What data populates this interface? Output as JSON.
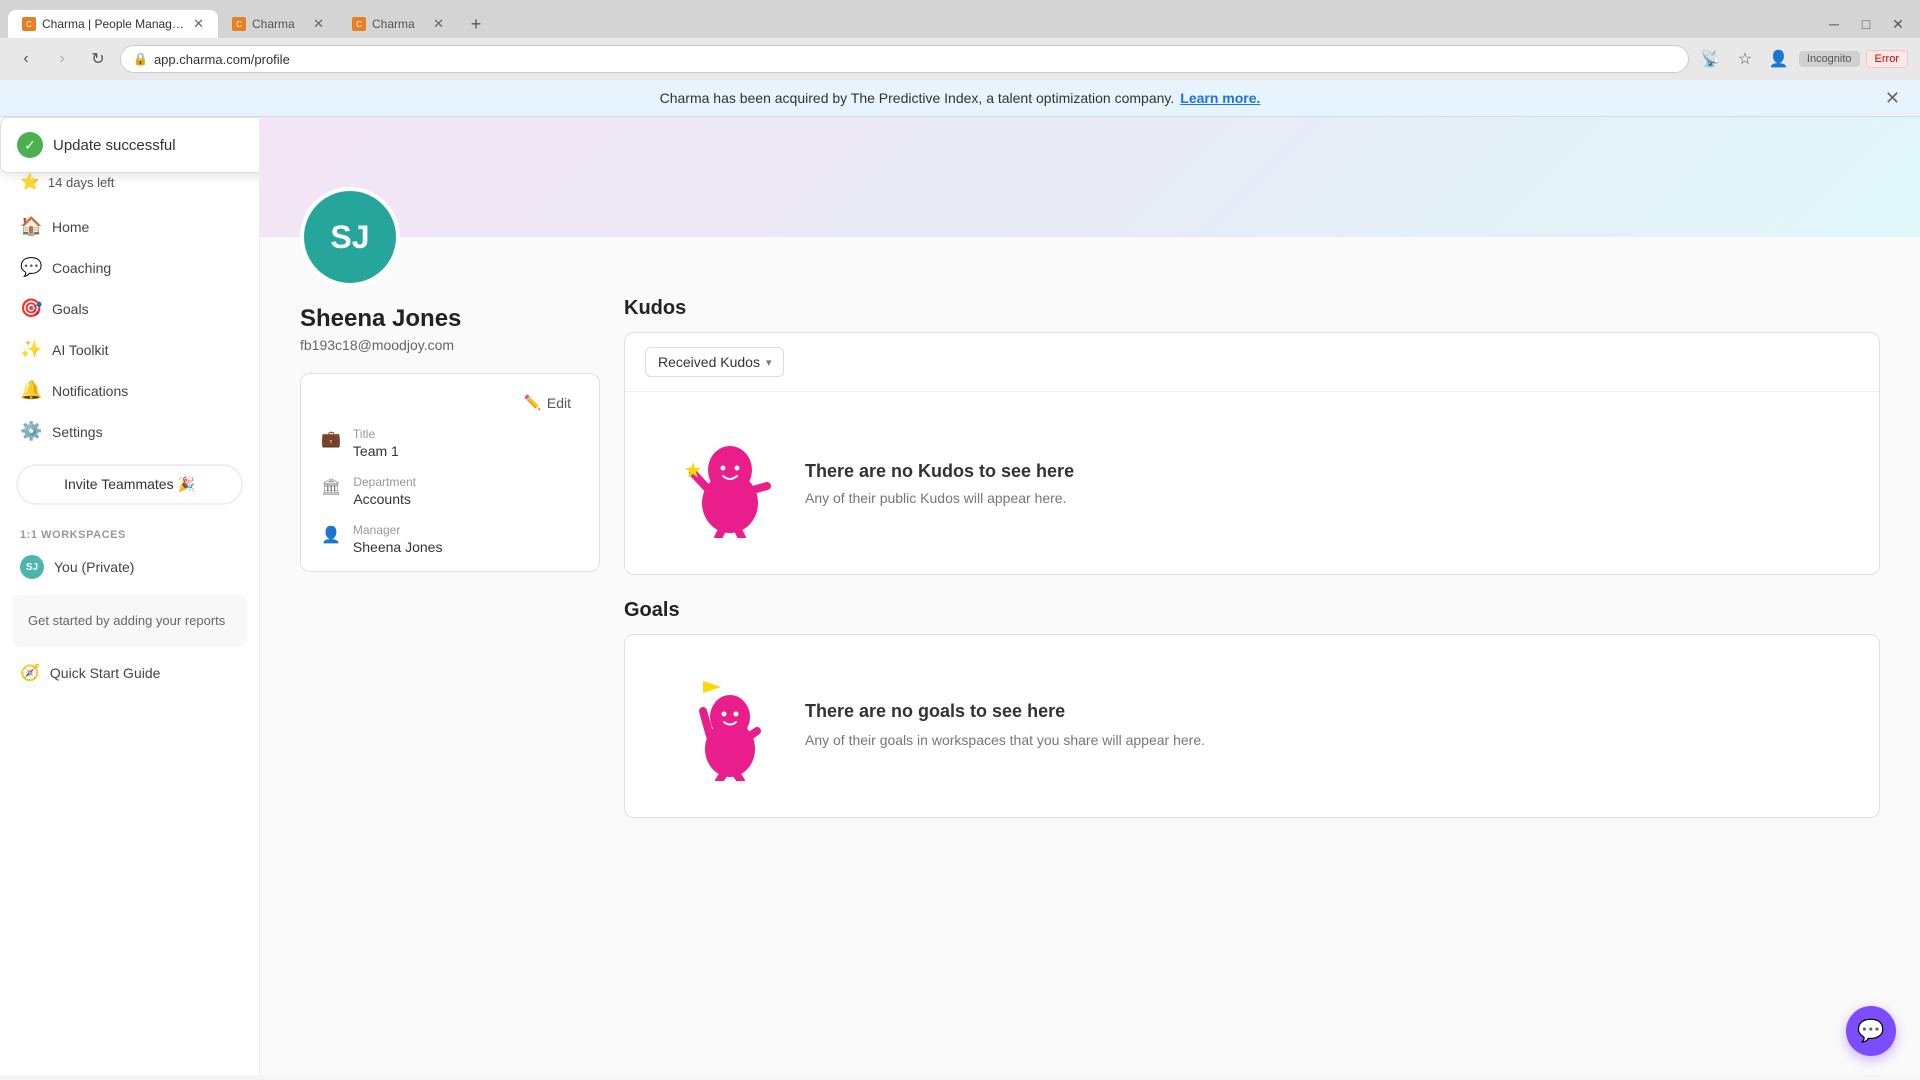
{
  "browser": {
    "tabs": [
      {
        "id": "tab1",
        "title": "Charma | People Management ...",
        "favicon_color": "#e67e22",
        "active": true
      },
      {
        "id": "tab2",
        "title": "Charma",
        "favicon_color": "#e67e22",
        "active": false
      },
      {
        "id": "tab3",
        "title": "Charma",
        "favicon_color": "#e67e22",
        "active": false
      }
    ],
    "url": "app.charma.com/profile",
    "incognito_label": "Incognito",
    "error_label": "Error"
  },
  "announcement": {
    "text": "Charma has been acquired by The Predictive Index, a talent optimization company.",
    "link_text": "Learn more."
  },
  "toast": {
    "message": "Update successful"
  },
  "sidebar": {
    "upgrade": "14 days left",
    "nav_items": [
      {
        "id": "home",
        "label": "Home",
        "icon": "🏠"
      },
      {
        "id": "coaching",
        "label": "Coaching",
        "icon": "💬"
      },
      {
        "id": "goals",
        "label": "Goals",
        "icon": "🎯"
      },
      {
        "id": "ai_toolkit",
        "label": "AI Toolkit",
        "icon": "✨"
      },
      {
        "id": "notifications",
        "label": "Notifications",
        "icon": "🔔"
      },
      {
        "id": "settings",
        "label": "Settings",
        "icon": "⚙️"
      }
    ],
    "invite_button": "Invite Teammates 🎉",
    "workspaces_title": "1:1 Workspaces",
    "workspace_items": [
      {
        "id": "you_private",
        "label": "You (Private)",
        "initials": "SJ"
      }
    ],
    "get_started_text": "Get started by adding your reports",
    "quick_start_label": "Quick Start Guide"
  },
  "profile": {
    "initials": "SJ",
    "name": "Sheena Jones",
    "email": "fb193c18@moodjoy.com",
    "title_label": "Title",
    "title_value": "Team 1",
    "department_label": "Department",
    "department_value": "Accounts",
    "manager_label": "Manager",
    "manager_value": "Sheena Jones",
    "edit_label": "Edit"
  },
  "kudos": {
    "section_title": "Kudos",
    "filter_label": "Received Kudos",
    "empty_title": "There are no Kudos to see here",
    "empty_sub": "Any of their public Kudos will appear here."
  },
  "goals": {
    "section_title": "Goals",
    "empty_title": "There are no goals to see here",
    "empty_sub": "Any of their goals in workspaces that you share will appear here."
  }
}
